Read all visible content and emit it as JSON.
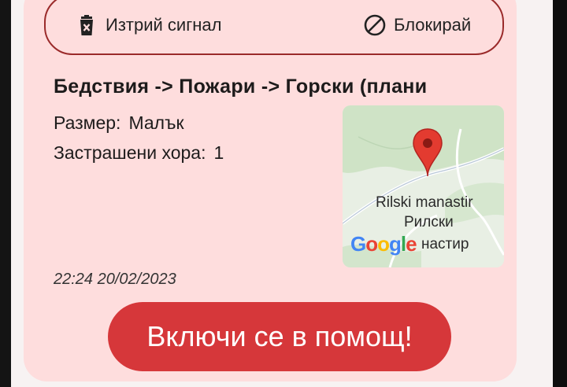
{
  "actions": {
    "delete_label": "Изтрий сигнал",
    "block_label": "Блокирай"
  },
  "signal": {
    "category_path": "Бедствия -> Пожари -> Горски (плани",
    "size_label": "Размер:",
    "size_value": "Малък",
    "people_label": "Застрашени хора:",
    "people_value": "1",
    "timestamp": "22:24 20/02/2023"
  },
  "map": {
    "place_name": "Rilski manastir",
    "place_local_line1": "Рилски",
    "place_local_line2": "настир",
    "provider_logo": "Google",
    "marker_color": "#e33b30"
  },
  "help_button": {
    "label": "Включи се в помощ!"
  },
  "colors": {
    "card_background": "#fedddd",
    "accent_outline": "#9a2a2a",
    "primary_button": "#d6373a"
  }
}
